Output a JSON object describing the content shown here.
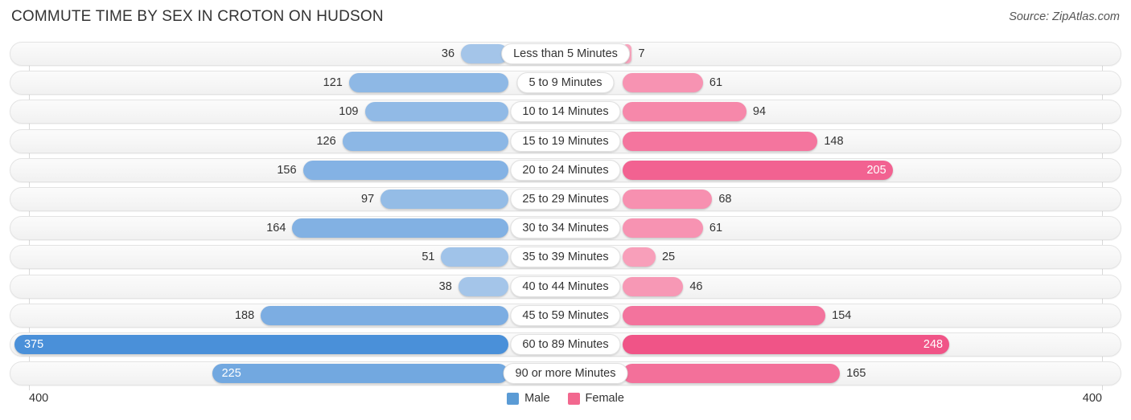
{
  "header": {
    "title": "COMMUTE TIME BY SEX IN CROTON ON HUDSON",
    "source": "Source: ZipAtlas.com"
  },
  "axis": {
    "left_max_label": "400",
    "right_max_label": "400"
  },
  "legend": {
    "items": [
      {
        "label": "Male",
        "color": "#5b9bd5"
      },
      {
        "label": "Female",
        "color": "#f2688f"
      }
    ]
  },
  "chart_data": {
    "type": "bar",
    "subtype": "diverging-bidirectional-bar",
    "title": "COMMUTE TIME BY SEX IN CROTON ON HUDSON",
    "xlabel": "",
    "ylabel": "",
    "xlim": [
      400,
      400
    ],
    "axis_max": 400,
    "grid": true,
    "legend_position": "bottom-center",
    "categories": [
      "Less than 5 Minutes",
      "5 to 9 Minutes",
      "10 to 14 Minutes",
      "15 to 19 Minutes",
      "20 to 24 Minutes",
      "25 to 29 Minutes",
      "30 to 34 Minutes",
      "35 to 39 Minutes",
      "40 to 44 Minutes",
      "45 to 59 Minutes",
      "60 to 89 Minutes",
      "90 or more Minutes"
    ],
    "series": [
      {
        "name": "Male",
        "direction": "left",
        "color": "#5b9bd5",
        "values": [
          36,
          121,
          109,
          126,
          156,
          97,
          164,
          51,
          38,
          188,
          375,
          225
        ]
      },
      {
        "name": "Female",
        "direction": "right",
        "color": "#f2688f",
        "values": [
          7,
          61,
          94,
          148,
          205,
          68,
          61,
          25,
          46,
          154,
          248,
          165
        ]
      }
    ],
    "rows": [
      {
        "category": "Less than 5 Minutes",
        "male": 36,
        "male_label": "36",
        "female": 7,
        "female_label": "7"
      },
      {
        "category": "5 to 9 Minutes",
        "male": 121,
        "male_label": "121",
        "female": 61,
        "female_label": "61"
      },
      {
        "category": "10 to 14 Minutes",
        "male": 109,
        "male_label": "109",
        "female": 94,
        "female_label": "94"
      },
      {
        "category": "15 to 19 Minutes",
        "male": 126,
        "male_label": "126",
        "female": 148,
        "female_label": "148"
      },
      {
        "category": "20 to 24 Minutes",
        "male": 156,
        "male_label": "156",
        "female": 205,
        "female_label": "205"
      },
      {
        "category": "25 to 29 Minutes",
        "male": 97,
        "male_label": "97",
        "female": 68,
        "female_label": "68"
      },
      {
        "category": "30 to 34 Minutes",
        "male": 164,
        "male_label": "164",
        "female": 61,
        "female_label": "61"
      },
      {
        "category": "35 to 39 Minutes",
        "male": 51,
        "male_label": "51",
        "female": 25,
        "female_label": "25"
      },
      {
        "category": "40 to 44 Minutes",
        "male": 38,
        "male_label": "38",
        "female": 46,
        "female_label": "46"
      },
      {
        "category": "45 to 59 Minutes",
        "male": 188,
        "male_label": "188",
        "female": 154,
        "female_label": "154"
      },
      {
        "category": "60 to 89 Minutes",
        "male": 375,
        "male_label": "375",
        "female": 248,
        "female_label": "248"
      },
      {
        "category": "90 or more Minutes",
        "male": 225,
        "male_label": "225",
        "female": 165,
        "female_label": "165"
      }
    ]
  }
}
